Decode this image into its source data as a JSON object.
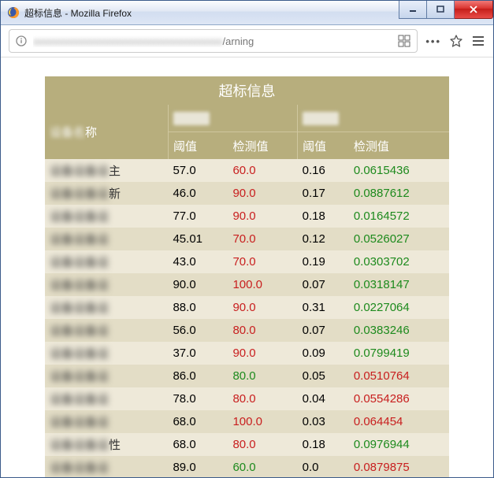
{
  "window": {
    "title": "超标信息 - Mozilla Firefox"
  },
  "url": {
    "visible_tail": "/arning"
  },
  "table": {
    "title": "超标信息",
    "name_header_suffix": "称",
    "sub_headers": {
      "threshold": "阈值",
      "measured": "检测值"
    }
  },
  "rows": [
    {
      "name_suffix": "主",
      "v1": "57.0",
      "d1": "60.0",
      "d1c": "red",
      "v2": "0.16",
      "d2": "0.0615436",
      "d2c": "green"
    },
    {
      "name_suffix": "新",
      "v1": "46.0",
      "d1": "90.0",
      "d1c": "red",
      "v2": "0.17",
      "d2": "0.0887612",
      "d2c": "green"
    },
    {
      "name_suffix": "",
      "v1": "77.0",
      "d1": "90.0",
      "d1c": "red",
      "v2": "0.18",
      "d2": "0.0164572",
      "d2c": "green"
    },
    {
      "name_suffix": "",
      "v1": "45.01",
      "d1": "70.0",
      "d1c": "red",
      "v2": "0.12",
      "d2": "0.0526027",
      "d2c": "green"
    },
    {
      "name_suffix": "",
      "v1": "43.0",
      "d1": "70.0",
      "d1c": "red",
      "v2": "0.19",
      "d2": "0.0303702",
      "d2c": "green"
    },
    {
      "name_suffix": "",
      "v1": "90.0",
      "d1": "100.0",
      "d1c": "red",
      "v2": "0.07",
      "d2": "0.0318147",
      "d2c": "green"
    },
    {
      "name_suffix": "",
      "v1": "88.0",
      "d1": "90.0",
      "d1c": "red",
      "v2": "0.31",
      "d2": "0.0227064",
      "d2c": "green"
    },
    {
      "name_suffix": "",
      "v1": "56.0",
      "d1": "80.0",
      "d1c": "red",
      "v2": "0.07",
      "d2": "0.0383246",
      "d2c": "green"
    },
    {
      "name_suffix": "",
      "v1": "37.0",
      "d1": "90.0",
      "d1c": "red",
      "v2": "0.09",
      "d2": "0.0799419",
      "d2c": "green"
    },
    {
      "name_suffix": "",
      "v1": "86.0",
      "d1": "80.0",
      "d1c": "green",
      "v2": "0.05",
      "d2": "0.0510764",
      "d2c": "red"
    },
    {
      "name_suffix": "",
      "v1": "78.0",
      "d1": "80.0",
      "d1c": "red",
      "v2": "0.04",
      "d2": "0.0554286",
      "d2c": "red"
    },
    {
      "name_suffix": "",
      "v1": "68.0",
      "d1": "100.0",
      "d1c": "red",
      "v2": "0.03",
      "d2": "0.064454",
      "d2c": "red"
    },
    {
      "name_suffix": "性",
      "v1": "68.0",
      "d1": "80.0",
      "d1c": "red",
      "v2": "0.18",
      "d2": "0.0976944",
      "d2c": "green"
    },
    {
      "name_suffix": "",
      "v1": "89.0",
      "d1": "60.0",
      "d1c": "green",
      "v2": "0.0",
      "d2": "0.0879875",
      "d2c": "red"
    }
  ]
}
